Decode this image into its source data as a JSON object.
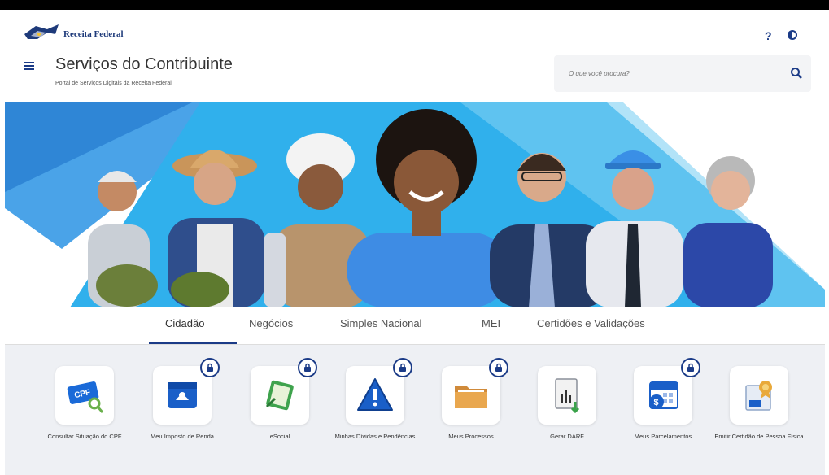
{
  "header": {
    "logo_text": "Receita Federal",
    "title": "Serviços do Contribuinte",
    "subtitle": "Portal de Serviços Digitais da Receita Federal",
    "help_label": "?",
    "search_placeholder": "O que você procura?"
  },
  "tabs": [
    {
      "label": "Cidadão",
      "active": true
    },
    {
      "label": "Negócios",
      "active": false
    },
    {
      "label": "Simples Nacional",
      "active": false
    },
    {
      "label": "MEI",
      "active": false
    },
    {
      "label": "Certidões e Validações",
      "active": false
    }
  ],
  "tiles": [
    {
      "label": "Consultar Situação do CPF",
      "icon": "cpf-card-icon",
      "locked": false
    },
    {
      "label": "Meu Imposto de Renda",
      "icon": "lion-income-tax-icon",
      "locked": true
    },
    {
      "label": "eSocial",
      "icon": "esocial-icon",
      "locked": true
    },
    {
      "label": "Minhas Dívidas e Pendências",
      "icon": "warning-triangle-icon",
      "locked": true
    },
    {
      "label": "Meus Processos",
      "icon": "folder-icon",
      "locked": true
    },
    {
      "label": "Gerar DARF",
      "icon": "darf-document-icon",
      "locked": false
    },
    {
      "label": "Meus Parcelamentos",
      "icon": "calendar-payment-icon",
      "locked": true
    },
    {
      "label": "Emitir Certidão de Pessoa Física",
      "icon": "certificate-icon",
      "locked": false
    }
  ],
  "colors": {
    "brand": "#1b3b87",
    "banner_blue": "#29a8e8",
    "tiles_background": "#eef0f4"
  }
}
